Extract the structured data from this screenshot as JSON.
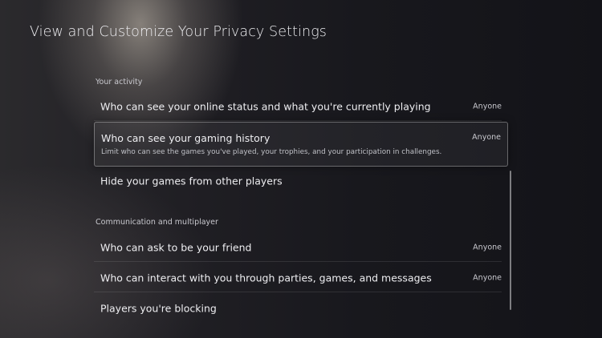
{
  "page": {
    "title": "View and Customize Your Privacy Settings"
  },
  "sections": [
    {
      "header": "Your activity",
      "items": [
        {
          "label": "Who can see your online status and what you're currently playing",
          "value": "Anyone"
        },
        {
          "label": "Who can see your gaming history",
          "value": "Anyone",
          "description": "Limit who can see the games you've played, your trophies, and your participation in challenges."
        },
        {
          "label": "Hide your games from other players",
          "value": ""
        }
      ]
    },
    {
      "header": "Communication and multiplayer",
      "items": [
        {
          "label": "Who can ask to be your friend",
          "value": "Anyone"
        },
        {
          "label": "Who can interact with you through parties, games, and messages",
          "value": "Anyone"
        },
        {
          "label": "Players you're blocking",
          "value": ""
        }
      ]
    }
  ],
  "focused_item": "Who can see your gaming history"
}
